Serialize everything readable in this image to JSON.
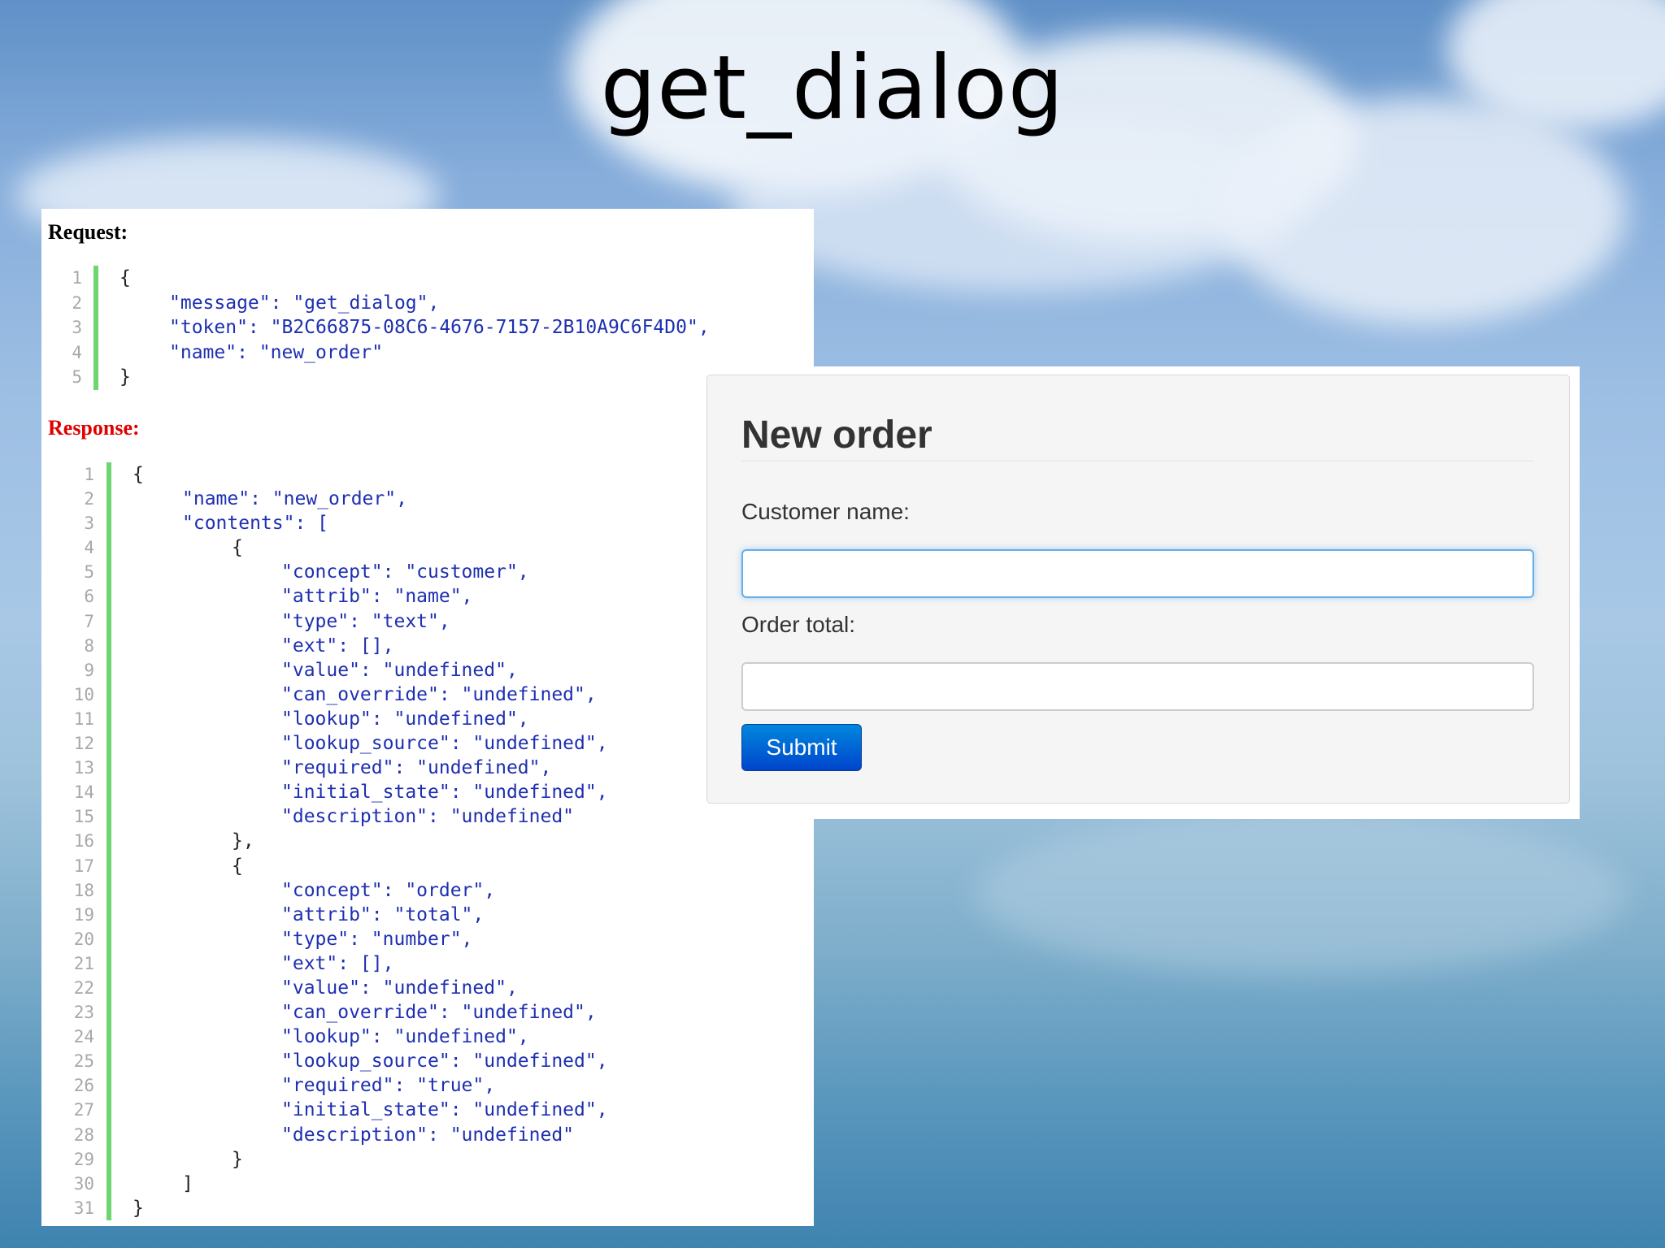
{
  "slide": {
    "title": "get_dialog"
  },
  "request": {
    "label": "Request:",
    "lines": [
      {
        "n": "1",
        "indent": 0,
        "text": "{"
      },
      {
        "n": "2",
        "indent": 1,
        "text": "\"message\": \"get_dialog\","
      },
      {
        "n": "3",
        "indent": 1,
        "text": "\"token\": \"B2C66875-08C6-4676-7157-2B10A9C6F4D0\","
      },
      {
        "n": "4",
        "indent": 1,
        "text": "\"name\": \"new_order\""
      },
      {
        "n": "5",
        "indent": 0,
        "text": "}"
      }
    ]
  },
  "response": {
    "label": "Response:",
    "lines": [
      {
        "n": "1",
        "indent": 0,
        "text": "{"
      },
      {
        "n": "2",
        "indent": 1,
        "text": "\"name\": \"new_order\","
      },
      {
        "n": "3",
        "indent": 1,
        "text": "\"contents\": ["
      },
      {
        "n": "4",
        "indent": 2,
        "text": "{"
      },
      {
        "n": "5",
        "indent": 3,
        "text": "\"concept\": \"customer\","
      },
      {
        "n": "6",
        "indent": 3,
        "text": "\"attrib\": \"name\","
      },
      {
        "n": "7",
        "indent": 3,
        "text": "\"type\": \"text\","
      },
      {
        "n": "8",
        "indent": 3,
        "text": "\"ext\": [],"
      },
      {
        "n": "9",
        "indent": 3,
        "text": "\"value\": \"undefined\","
      },
      {
        "n": "10",
        "indent": 3,
        "text": "\"can_override\": \"undefined\","
      },
      {
        "n": "11",
        "indent": 3,
        "text": "\"lookup\": \"undefined\","
      },
      {
        "n": "12",
        "indent": 3,
        "text": "\"lookup_source\": \"undefined\","
      },
      {
        "n": "13",
        "indent": 3,
        "text": "\"required\": \"undefined\","
      },
      {
        "n": "14",
        "indent": 3,
        "text": "\"initial_state\": \"undefined\","
      },
      {
        "n": "15",
        "indent": 3,
        "text": "\"description\": \"undefined\""
      },
      {
        "n": "16",
        "indent": 2,
        "text": "},"
      },
      {
        "n": "17",
        "indent": 2,
        "text": "{"
      },
      {
        "n": "18",
        "indent": 3,
        "text": "\"concept\": \"order\","
      },
      {
        "n": "19",
        "indent": 3,
        "text": "\"attrib\": \"total\","
      },
      {
        "n": "20",
        "indent": 3,
        "text": "\"type\": \"number\","
      },
      {
        "n": "21",
        "indent": 3,
        "text": "\"ext\": [],"
      },
      {
        "n": "22",
        "indent": 3,
        "text": "\"value\": \"undefined\","
      },
      {
        "n": "23",
        "indent": 3,
        "text": "\"can_override\": \"undefined\","
      },
      {
        "n": "24",
        "indent": 3,
        "text": "\"lookup\": \"undefined\","
      },
      {
        "n": "25",
        "indent": 3,
        "text": "\"lookup_source\": \"undefined\","
      },
      {
        "n": "26",
        "indent": 3,
        "text": "\"required\": \"true\","
      },
      {
        "n": "27",
        "indent": 3,
        "text": "\"initial_state\": \"undefined\","
      },
      {
        "n": "28",
        "indent": 3,
        "text": "\"description\": \"undefined\""
      },
      {
        "n": "29",
        "indent": 2,
        "text": "}"
      },
      {
        "n": "30",
        "indent": 1,
        "text": "]"
      },
      {
        "n": "31",
        "indent": 0,
        "text": "}"
      }
    ]
  },
  "dialog": {
    "title": "New order",
    "fields": [
      {
        "label": "Customer name:",
        "value": "",
        "focused": true
      },
      {
        "label": "Order total:",
        "value": "",
        "focused": false
      }
    ],
    "submit_label": "Submit"
  },
  "colors": {
    "code_string": "#1e2fb0",
    "line_number": "#a8a8a8",
    "gutter_bar": "#6ed66e",
    "response_label": "#e00000",
    "submit_button": "#0055cc",
    "focus_border": "#66afe9"
  }
}
